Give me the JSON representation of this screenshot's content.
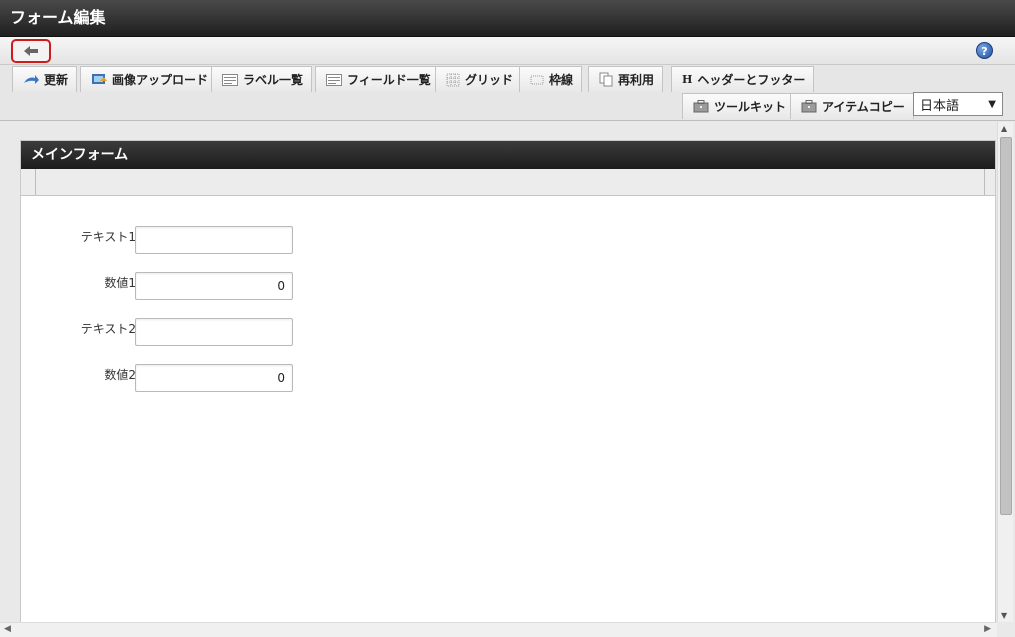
{
  "window": {
    "title": "フォーム編集"
  },
  "toolbar": {
    "row1": [
      {
        "label": "更新",
        "icon": "update-icon"
      },
      {
        "label": "画像アップロード",
        "icon": "image-upload-icon"
      },
      {
        "label": "ラベル一覧",
        "icon": "list-icon"
      },
      {
        "label": "フィールド一覧",
        "icon": "list-icon"
      },
      {
        "label": "グリッド",
        "icon": "grid-icon"
      },
      {
        "label": "枠線",
        "icon": "border-icon"
      },
      {
        "label": "再利用",
        "icon": "copy-icon"
      },
      {
        "label": "ヘッダーとフッター",
        "icon": "header-icon",
        "glyph": "H"
      }
    ],
    "row2": [
      {
        "label": "ツールキット",
        "icon": "toolbox-icon"
      },
      {
        "label": "アイテムコピー",
        "icon": "toolbox-icon"
      }
    ],
    "language": "日本語"
  },
  "panel": {
    "title": "メインフォーム"
  },
  "fields": [
    {
      "label": "テキスト1",
      "value": ""
    },
    {
      "label": "数値1",
      "value": "0"
    },
    {
      "label": "テキスト2",
      "value": ""
    },
    {
      "label": "数値2",
      "value": "0"
    }
  ],
  "help_glyph": "?",
  "accent_color": "#d21a1a"
}
